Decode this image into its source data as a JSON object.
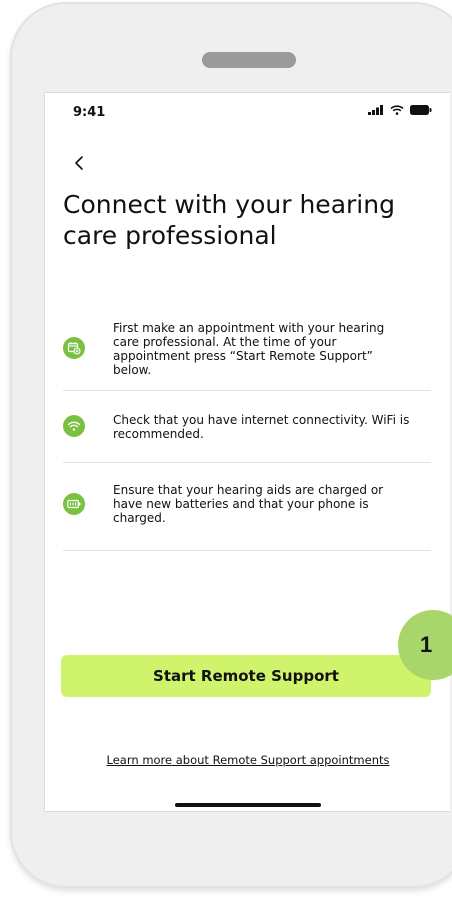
{
  "status_bar": {
    "time": "9:41",
    "icons": [
      "cellular-signal-icon",
      "wifi-icon",
      "battery-icon"
    ]
  },
  "header": {
    "back_icon": "back-chevron-icon",
    "title": "Connect with your hearing care professional"
  },
  "steps": [
    {
      "icon": "calendar-add-icon",
      "text": "First make an appointment with your hearing care professional. At the time of your appointment press “Start Remote Support” below."
    },
    {
      "icon": "wifi-icon",
      "text": "Check that you have internet connectivity. WiFi is recommended."
    },
    {
      "icon": "battery-icon",
      "text": "Ensure that your hearing aids are charged or have new batteries and that your phone is charged."
    }
  ],
  "actions": {
    "start_label": "Start Remote Support",
    "learn_more_label": "Learn more about Remote Support appointments"
  },
  "callout": {
    "number": "1"
  },
  "colors": {
    "accent_button": "#cff46c",
    "icon_green": "#7ac142",
    "callout": "#a9d66b"
  }
}
